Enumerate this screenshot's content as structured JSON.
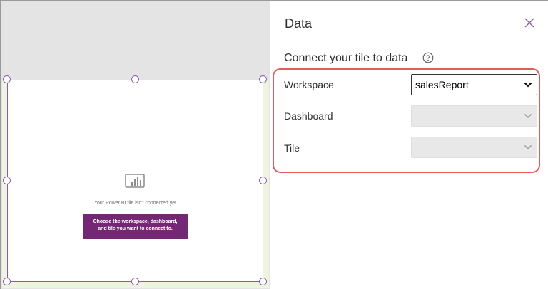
{
  "tile": {
    "message": "Your Power BI tile isn't connected yet",
    "button_line1": "Choose the workspace, dashboard,",
    "button_line2": "and tile you want to connect to."
  },
  "pane": {
    "title": "Data",
    "subtitle": "Connect your tile to data",
    "fields": {
      "workspace": {
        "label": "Workspace",
        "value": "salesReport"
      },
      "dashboard": {
        "label": "Dashboard",
        "value": ""
      },
      "tile": {
        "label": "Tile",
        "value": ""
      }
    }
  },
  "icons": {
    "close": "close-icon",
    "help": "help-icon",
    "chevron": "chevron-down-icon",
    "report": "power-bi-report-icon"
  },
  "colors": {
    "accent": "#742774",
    "selection": "#8a5fa0",
    "highlight": "#e05c5c"
  }
}
